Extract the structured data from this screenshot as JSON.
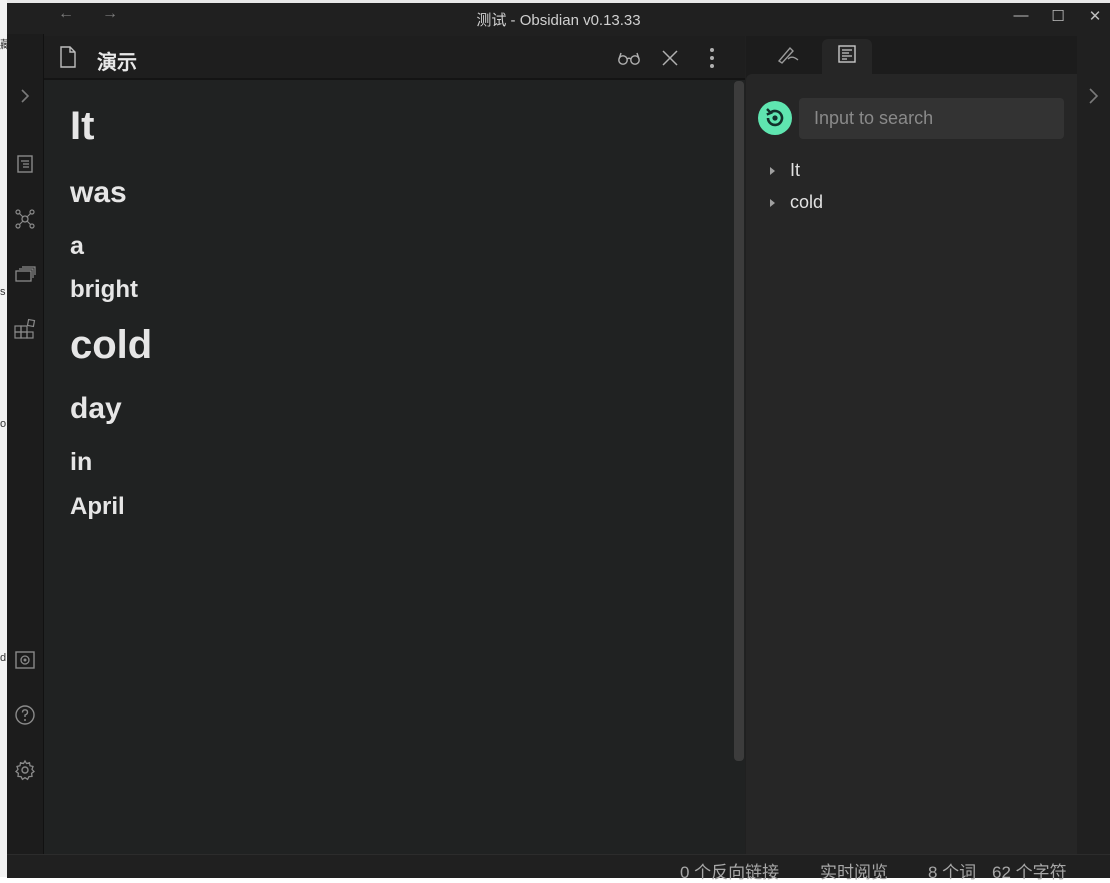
{
  "window": {
    "title": "测试 - Obsidian v0.13.33",
    "back_glyph": "←",
    "forward_glyph": "→",
    "minimize_glyph": "—",
    "maximize_glyph": "☐",
    "close_glyph": "✕"
  },
  "ribbon": {
    "icons": [
      "collapse-left-icon",
      "file-explorer-icon",
      "graph-view-icon",
      "slides-icon",
      "plugins-grid-icon",
      "vault-icon",
      "help-icon",
      "settings-icon"
    ]
  },
  "editor": {
    "view_title": "演示",
    "header_icons": [
      "reading-mode-glasses-icon",
      "close-icon",
      "more-options-icon"
    ],
    "headings": [
      {
        "text": "It",
        "level": 1
      },
      {
        "text": "was",
        "level": 2
      },
      {
        "text": "a",
        "level": 3
      },
      {
        "text": "bright",
        "level": 4
      },
      {
        "text": "cold",
        "level": 1
      },
      {
        "text": "day",
        "level": 2
      },
      {
        "text": "in",
        "level": 3
      },
      {
        "text": "April",
        "level": 4
      }
    ]
  },
  "right_sidebar": {
    "tabs": [
      "pen-icon",
      "outline-icon"
    ],
    "search_placeholder": "Input to search",
    "outline_items": [
      "It",
      "cold"
    ],
    "accent_color": "#5fe5b0"
  },
  "status_bar": {
    "backlinks": "0 个反向链接",
    "live_preview": "实时阅览",
    "word_count": "8 个词",
    "char_count": "62 个字符"
  }
}
